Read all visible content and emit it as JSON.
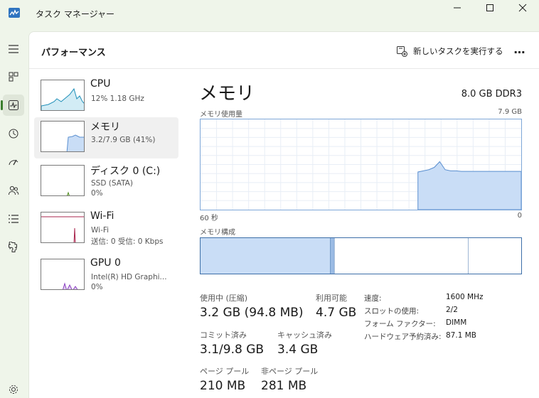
{
  "window": {
    "title": "タスク マネージャー",
    "accent_color": "#3a7d2c",
    "buttons": [
      "minimize-icon",
      "maximize-icon",
      "close-icon"
    ]
  },
  "sidebar": {
    "items": [
      {
        "icon": "hamburger-menu-icon"
      },
      {
        "icon": "processes-icon"
      },
      {
        "icon": "performance-icon",
        "active": true
      },
      {
        "icon": "app-history-icon"
      },
      {
        "icon": "startup-apps-icon"
      },
      {
        "icon": "users-icon"
      },
      {
        "icon": "details-icon"
      },
      {
        "icon": "services-icon"
      },
      {
        "icon": "settings-icon"
      }
    ]
  },
  "header": {
    "title": "パフォーマンス",
    "run_task_label": "新しいタスクを実行する",
    "more_label": "…"
  },
  "resources": [
    {
      "name": "CPU",
      "sub1": "12%  1.18 GHz",
      "color": "#1f8fb8"
    },
    {
      "name": "メモリ",
      "sub1": "3.2/7.9 GB (41%)",
      "color": "#3d6fa8",
      "active": true
    },
    {
      "name": "ディスク 0 (C:)",
      "sub1": "SSD (SATA)",
      "sub2": "0%",
      "color": "#4f8c1e"
    },
    {
      "name": "Wi-Fi",
      "sub1": "Wi-Fi",
      "sub2": "送信: 0 受信: 0 Kbps",
      "color": "#a8244c"
    },
    {
      "name": "GPU 0",
      "sub1": "Intel(R) HD Graphi...",
      "sub2": "0%",
      "color": "#8a3fc0"
    }
  ],
  "memory": {
    "title": "メモリ",
    "spec": "8.0 GB DDR3",
    "usage_label": "メモリ使用量",
    "usage_max": "7.9 GB",
    "axis_left": "60 秒",
    "axis_right": "0",
    "composition_label": "メモリ構成",
    "graph_color": "#c9ddf6",
    "graph_line_color": "#5a8fd0",
    "usage_series_gb": [
      0,
      0,
      0,
      0,
      0,
      0,
      0,
      0,
      0,
      0,
      0,
      0,
      0,
      0,
      0,
      0,
      0,
      0,
      0,
      0,
      0,
      0,
      0,
      0,
      0,
      0,
      0,
      0,
      0,
      0,
      0,
      0,
      0,
      0,
      0,
      0,
      0,
      0,
      0,
      0,
      3.3,
      3.4,
      3.5,
      3.7,
      4.2,
      3.5,
      3.4,
      3.4,
      3.35,
      3.35,
      3.35,
      3.35,
      3.35,
      3.35,
      3.35,
      3.35,
      3.35,
      3.35,
      3.35,
      3.35
    ],
    "composition_gb": {
      "in_use": 3.2,
      "modified": 0.1,
      "standby": 3.3,
      "free": 1.3
    }
  },
  "stats": {
    "in_use_label": "使用中 (圧縮)",
    "in_use_value": "3.2 GB (94.8 MB)",
    "available_label": "利用可能",
    "available_value": "4.7 GB",
    "committed_label": "コミット済み",
    "committed_value": "3.1/9.8 GB",
    "cached_label": "キャッシュ済み",
    "cached_value": "3.4 GB",
    "paged_label": "ページ プール",
    "paged_value": "210 MB",
    "nonpaged_label": "非ページ プール",
    "nonpaged_value": "281 MB"
  },
  "details": [
    {
      "label": "速度:",
      "value": "1600 MHz"
    },
    {
      "label": "スロットの使用:",
      "value": "2/2"
    },
    {
      "label": "フォーム ファクター:",
      "value": "DIMM"
    },
    {
      "label": "ハードウェア予約済み:",
      "value": "87.1 MB"
    }
  ]
}
